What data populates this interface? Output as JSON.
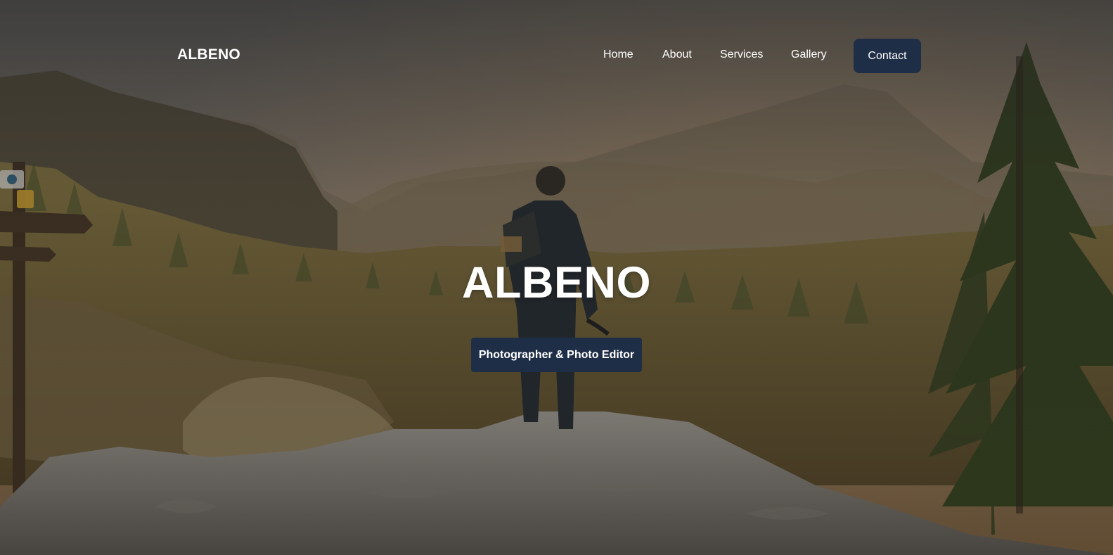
{
  "nav": {
    "brand": "ALBENO",
    "links": [
      "Home",
      "About",
      "Services",
      "Gallery"
    ],
    "contact": "Contact"
  },
  "hero": {
    "title": "ALBENO",
    "tagline": "Photographer & Photo Editor",
    "background_icon": "landscape-photo-hiker-on-rock"
  },
  "colors": {
    "accent": "#1f2e47",
    "text": "#ffffff"
  }
}
